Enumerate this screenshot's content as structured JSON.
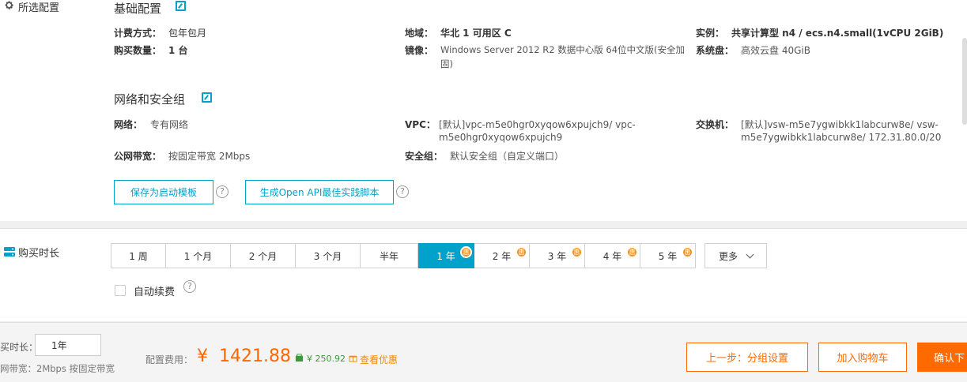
{
  "summary": {
    "title": "所选配置"
  },
  "basic": {
    "title": "基础配置",
    "billing_label": "计费方式：",
    "billing_value": "包年包月",
    "region_label": "地域：",
    "region_value": "华北 1 可用区 C",
    "instance_label": "实例：",
    "instance_value": "共享计算型 n4 / ecs.n4.small(1vCPU 2GiB)",
    "qty_label": "购买数量：",
    "qty_value": "1 台",
    "image_label": "镜像：",
    "image_value_1": "Windows Server 2012 R2 数据中心版 64位中文版(安全加",
    "image_value_2": "固)",
    "disk_label": "系统盘：",
    "disk_value": "高效云盘 40GiB"
  },
  "network": {
    "title": "网络和安全组",
    "net_label": "网络：",
    "net_value": "专有网络",
    "vpc_label": "VPC：",
    "vpc_value_1": "[默认]vpc-m5e0hgr0xyqow6xpujch9/ vpc-",
    "vpc_value_2": "m5e0hgr0xyqow6xpujch9",
    "vsw_label": "交换机：",
    "vsw_value_1": "[默认]vsw-m5e7ygwibkk1labcurw8e/ vsw-",
    "vsw_value_2": "m5e7ygwibkk1labcurw8e/ 172.31.80.0/20",
    "bw_label": "公网带宽：",
    "bw_value": "按固定带宽 2Mbps",
    "sg_label": "安全组：",
    "sg_value": "默认安全组（自定义端口）"
  },
  "actions": {
    "save_template": "保存为启动模板",
    "gen_api": "生成Open API最佳实践脚本",
    "help": "?"
  },
  "duration": {
    "title": "购买时长",
    "options": [
      {
        "label": "1 周"
      },
      {
        "label": "1 个月"
      },
      {
        "label": "2 个月"
      },
      {
        "label": "3 个月"
      },
      {
        "label": "半年"
      },
      {
        "label": "1 年",
        "badge": "惠"
      },
      {
        "label": "2 年",
        "badge": "惠"
      },
      {
        "label": "3 年",
        "badge": "惠"
      },
      {
        "label": "4 年",
        "badge": "惠"
      },
      {
        "label": "5 年",
        "badge": "惠"
      }
    ],
    "selected": "1 年",
    "more": "更多",
    "auto_renew": "自动续费"
  },
  "footer": {
    "duration_label": "买时长：",
    "duration_value": "1年",
    "bw_text": "网带宽：2Mbps 按固定带宽",
    "fee_label": "配置费用：",
    "currency": "¥",
    "price": "1421.88",
    "save_amount": "¥ 250.92",
    "view_discount": "查看优惠",
    "prev_button": "上一步：分组设置",
    "cart_button": "加入购物车",
    "confirm_button": "确认下"
  },
  "colors": {
    "accent": "#00a2ca",
    "orange": "#ff6a00",
    "badge": "#f39322"
  }
}
